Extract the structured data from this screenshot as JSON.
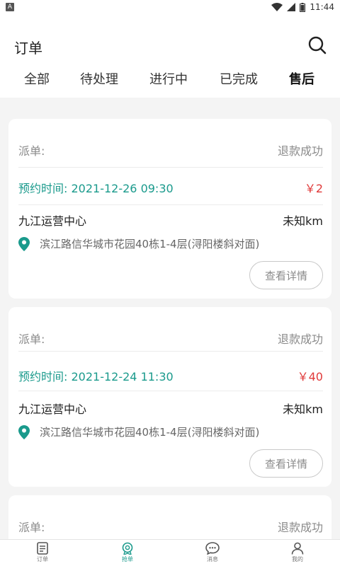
{
  "status_bar": {
    "app_badge": "A",
    "time": "11:44"
  },
  "header": {
    "title": "订单",
    "tabs": [
      {
        "label": "全部"
      },
      {
        "label": "待处理"
      },
      {
        "label": "进行中"
      },
      {
        "label": "已完成"
      },
      {
        "label": "售后"
      }
    ],
    "active_tab": "售后"
  },
  "orders": [
    {
      "dispatch_label": "派单:",
      "status": "退款成功",
      "appointment_label": "预约时间:",
      "appointment_time": "2021-12-26 09:30",
      "price": "￥2",
      "center": "九江运营中心",
      "distance": "未知km",
      "address": "滨江路信华城市花园40栋1-4层(浔阳楼斜对面)",
      "detail_label": "查看详情"
    },
    {
      "dispatch_label": "派单:",
      "status": "退款成功",
      "appointment_label": "预约时间:",
      "appointment_time": "2021-12-24 11:30",
      "price": "￥40",
      "center": "九江运营中心",
      "distance": "未知km",
      "address": "滨江路信华城市花园40栋1-4层(浔阳楼斜对面)",
      "detail_label": "查看详情"
    },
    {
      "dispatch_label": "派单:",
      "status": "退款成功"
    }
  ],
  "bottom_nav": [
    {
      "label": "订单",
      "icon": "order-list-icon"
    },
    {
      "label": "抢单",
      "icon": "grab-order-icon"
    },
    {
      "label": "消息",
      "icon": "chat-bubble-icon"
    },
    {
      "label": "我的",
      "icon": "person-icon"
    }
  ],
  "colors": {
    "accent": "#1a9a8c",
    "price": "#e03a3a",
    "background": "#f4f4f4"
  }
}
